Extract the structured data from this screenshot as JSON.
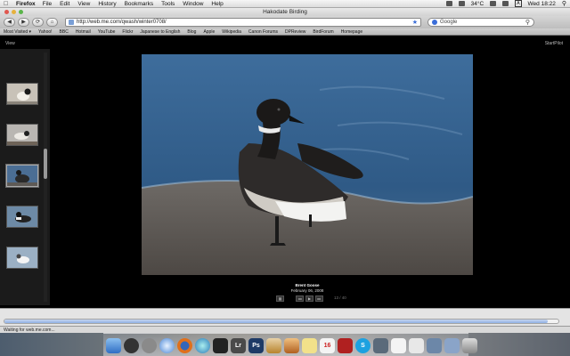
{
  "menubar": {
    "app": "Firefox",
    "items": [
      "File",
      "Edit",
      "View",
      "History",
      "Bookmarks",
      "Tools",
      "Window",
      "Help"
    ],
    "temperature": "34°C",
    "input_badge": "A",
    "clock": "Wed 18:22"
  },
  "window": {
    "title": "Hakodate Birding"
  },
  "toolbar": {
    "back": "◀",
    "forward": "▶",
    "reload": "⟳",
    "home": "⌂",
    "url": "http://web.me.com/qwash/winter0708/",
    "search_placeholder": "Google"
  },
  "bookmarks": [
    "Most Visited ▾",
    "Yahoo!",
    "BBC",
    "Hotmail",
    "YouTube",
    "Flickr",
    "Japanese to English",
    "Blog",
    "Apple",
    "Wikipedia",
    "Canon Forums",
    "DPReview",
    "BirdForum",
    "Homepage"
  ],
  "page": {
    "view_link": "View",
    "startpilot_link": "StartPilot",
    "caption_title": "Brent Goose",
    "caption_date": "February 06, 2008",
    "counter": "13 / 40",
    "controls": {
      "prev": "◂◂",
      "play": "▶",
      "next": "▸▸",
      "grid": "▦"
    }
  },
  "status": {
    "text": "Waiting for web.me.com..."
  },
  "icons": {
    "apple": "apple-icon",
    "search": "search-icon",
    "bookmark_star": "star-icon",
    "spotlight": "spotlight-icon"
  },
  "colors": {
    "accent": "#3a6dd8",
    "page_bg": "#000000",
    "sidebar_bg": "#1b1b1b"
  }
}
